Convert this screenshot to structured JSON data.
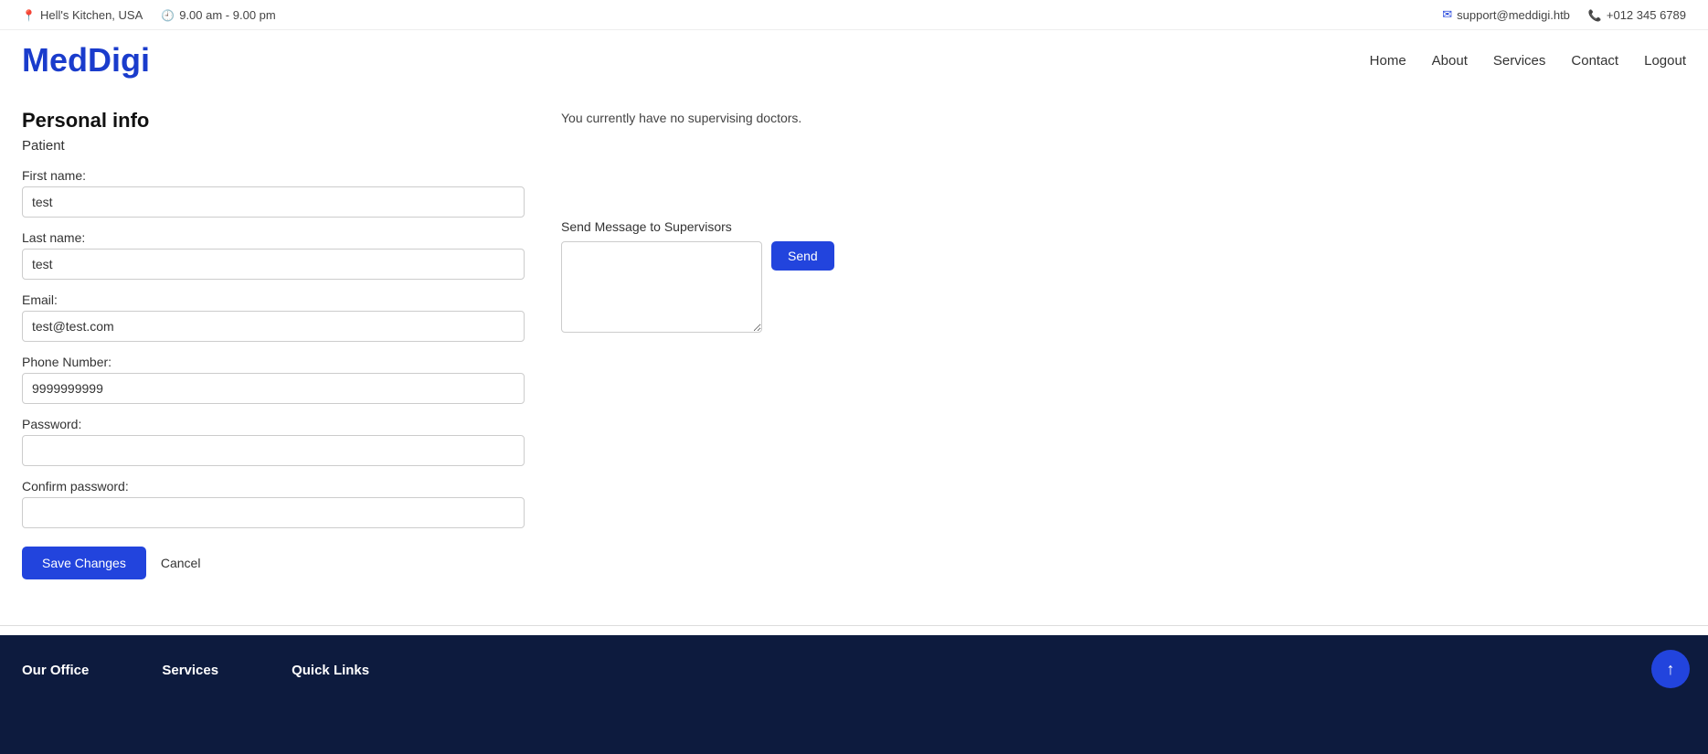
{
  "topbar": {
    "location": "Hell's Kitchen, USA",
    "hours": "9.00 am - 9.00 pm",
    "email": "support@meddigi.htb",
    "phone": "+012 345 6789"
  },
  "brand": {
    "name": "MedDigi"
  },
  "nav": {
    "items": [
      "Home",
      "About",
      "Services",
      "Contact",
      "Logout"
    ]
  },
  "form": {
    "title": "Personal info",
    "role": "Patient",
    "first_name_label": "First name:",
    "first_name_value": "test",
    "last_name_label": "Last name:",
    "last_name_value": "test",
    "email_label": "Email:",
    "email_value": "test@test.com",
    "phone_label": "Phone Number:",
    "phone_value": "9999999999",
    "password_label": "Password:",
    "password_value": "",
    "confirm_password_label": "Confirm password:",
    "confirm_password_value": "",
    "save_button": "Save Changes",
    "cancel_button": "Cancel"
  },
  "sidebar": {
    "no_doctors_text": "You currently have no supervising doctors.",
    "send_message_label": "Send Message to Supervisors",
    "send_button": "Send"
  },
  "footer": {
    "col1_title": "Our Office",
    "col2_title": "Services",
    "col3_title": "Quick Links"
  },
  "scroll_top_icon": "↑"
}
